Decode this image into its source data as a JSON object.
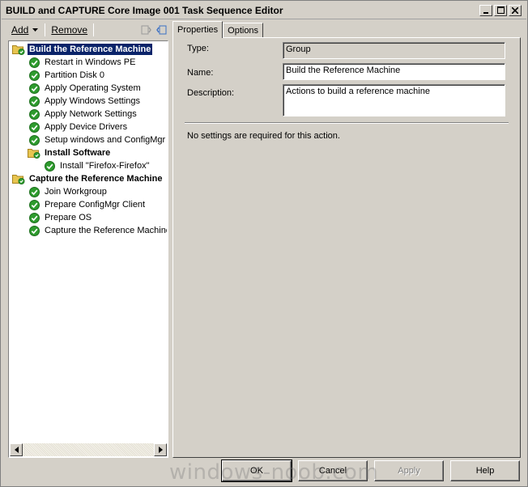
{
  "window": {
    "title": "BUILD and CAPTURE Core Image 001 Task Sequence Editor"
  },
  "toolbar": {
    "add_label": "Add",
    "remove_label": "Remove"
  },
  "tree": {
    "items": [
      {
        "label": "Build the Reference Machine",
        "kind": "group",
        "icon": "folder-check-icon"
      },
      {
        "label": "Restart in Windows PE",
        "kind": "step",
        "icon": "check-icon"
      },
      {
        "label": "Partition Disk 0",
        "kind": "step",
        "icon": "check-icon"
      },
      {
        "label": "Apply Operating System",
        "kind": "step",
        "icon": "check-icon"
      },
      {
        "label": "Apply Windows Settings",
        "kind": "step",
        "icon": "check-icon"
      },
      {
        "label": "Apply Network Settings",
        "kind": "step",
        "icon": "check-icon"
      },
      {
        "label": "Apply Device Drivers",
        "kind": "step",
        "icon": "check-icon"
      },
      {
        "label": "Setup windows and ConfigMgr",
        "kind": "step",
        "icon": "check-icon"
      },
      {
        "label": "Install Software",
        "kind": "group",
        "icon": "folder-check-icon"
      },
      {
        "label": "Install \"Firefox-Firefox\"",
        "kind": "step",
        "icon": "check-icon"
      },
      {
        "label": "Capture the Reference Machine",
        "kind": "group",
        "icon": "folder-check-icon"
      },
      {
        "label": "Join Workgroup",
        "kind": "step",
        "icon": "check-icon"
      },
      {
        "label": "Prepare ConfigMgr Client",
        "kind": "step",
        "icon": "check-icon"
      },
      {
        "label": "Prepare OS",
        "kind": "step",
        "icon": "check-icon"
      },
      {
        "label": "Capture the Reference Machine",
        "kind": "step",
        "icon": "check-icon"
      }
    ]
  },
  "tabs": [
    {
      "label": "Properties",
      "active": true
    },
    {
      "label": "Options",
      "active": false
    }
  ],
  "properties": {
    "type_label": "Type:",
    "type_value": "Group",
    "name_label": "Name:",
    "name_value": "Build the Reference Machine",
    "description_label": "Description:",
    "description_value": "Actions to build a reference machine",
    "info_text": "No settings are required  for this action."
  },
  "buttons": {
    "ok": "OK",
    "cancel": "Cancel",
    "apply": "Apply",
    "help": "Help"
  },
  "watermark": "windows-noob.com",
  "colors": {
    "selection": "#0a246a",
    "check_green": "#2e9b2e",
    "folder_yellow": "#e8c550",
    "face": "#d4d0c8"
  }
}
